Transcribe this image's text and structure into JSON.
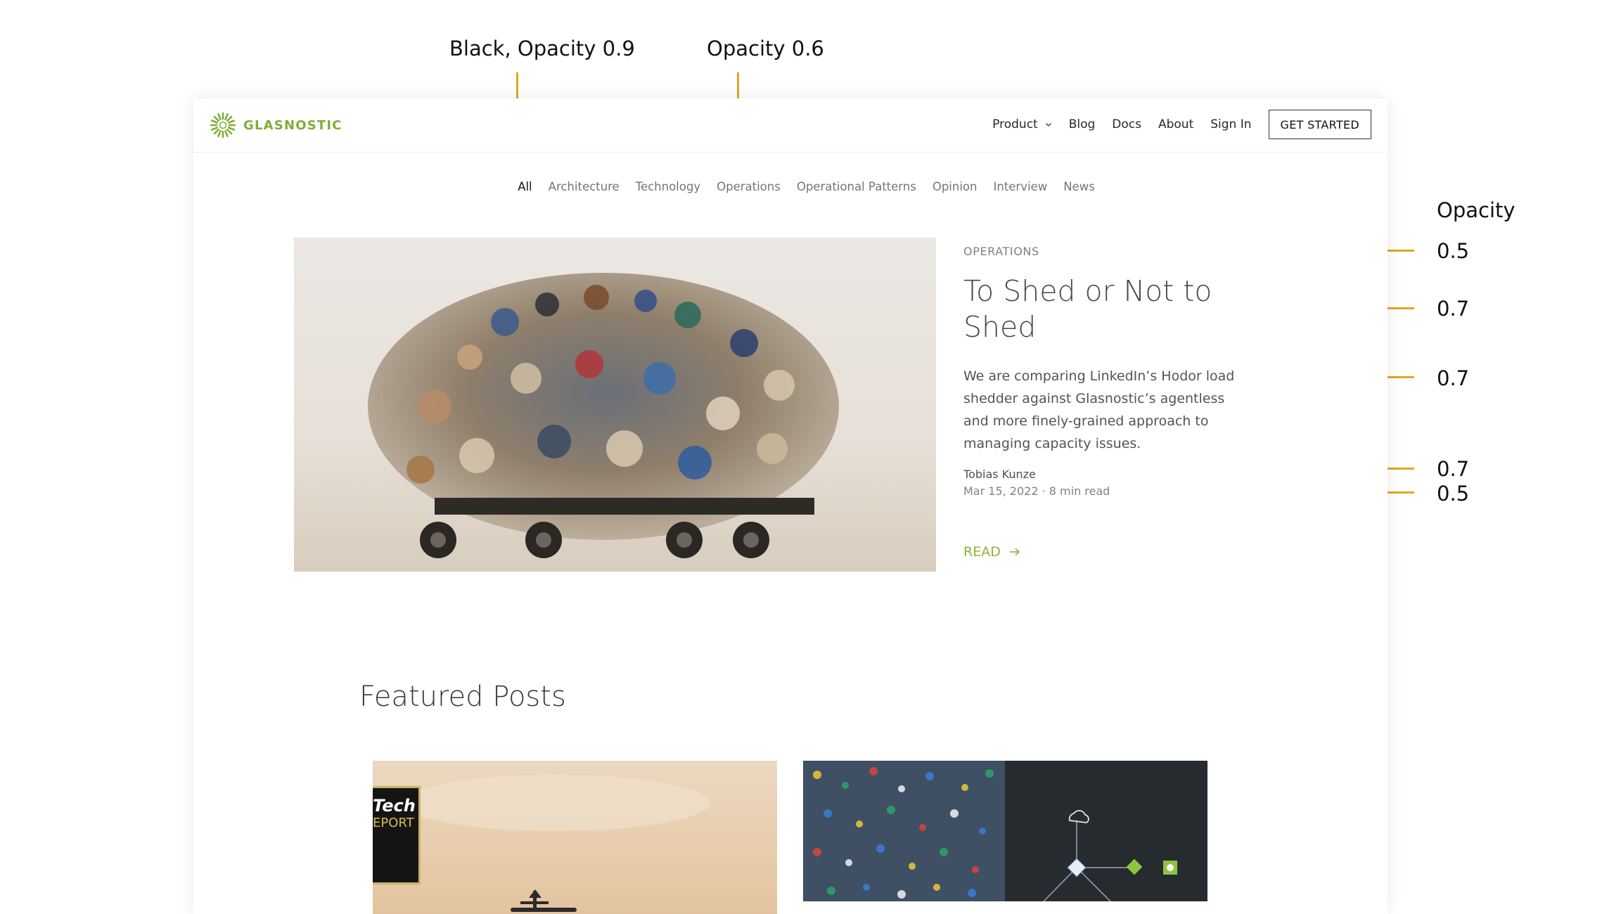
{
  "annotations": {
    "top_left": "Black, Opacity 0.9",
    "top_right": "Opacity 0.6",
    "right_heading": "Opacity",
    "right_values": [
      "0.5",
      "0.7",
      "0.7",
      "0.7",
      "0.5"
    ]
  },
  "colors": {
    "brand_green": "#7fae38",
    "read_green": "#8cb43a",
    "annotation_line": "#e3a623"
  },
  "header": {
    "logo_text": "GLASNOSTIC",
    "logo_icon": "sunburst-logo-icon",
    "nav": {
      "product": "Product",
      "blog": "Blog",
      "docs": "Docs",
      "about": "About",
      "sign_in": "Sign In",
      "cta": "GET STARTED"
    }
  },
  "categories": {
    "all": "All",
    "architecture": "Architecture",
    "technology": "Technology",
    "operations": "Operations",
    "operational_patterns": "Operational Patterns",
    "opinion": "Opinion",
    "interview": "Interview",
    "news": "News"
  },
  "hero": {
    "eyebrow": "OPERATIONS",
    "title": "To Shed or Not to Shed",
    "excerpt": "We are comparing LinkedIn’s Hodor load shedder against Glasnostic’s agentless and more finely-grained approach to managing capacity issues.",
    "author": "Tobias Kunze",
    "meta": "Mar 15, 2022 · 8 min read",
    "read": "READ",
    "read_icon": "arrow-right-icon"
  },
  "featured": {
    "heading": "Featured Posts",
    "card1_badge_line1": "Tech",
    "card1_badge_line2": "EPORT"
  }
}
